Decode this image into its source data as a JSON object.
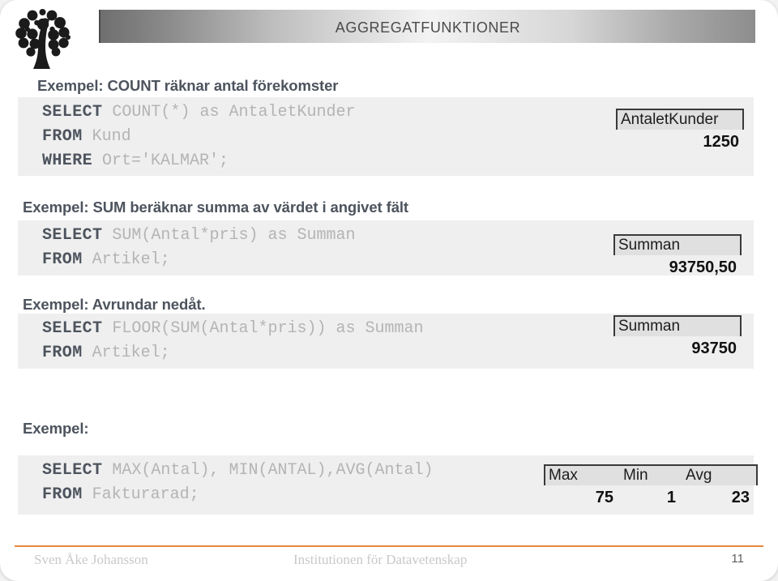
{
  "header": {
    "title": "Aggregatfunktioner",
    "logo_icon": "tree-logo-icon"
  },
  "sections": [
    {
      "heading": "Exempel:  COUNT räknar antal förekomster",
      "code_lines": [
        {
          "keyword": "SELECT",
          "rest": " COUNT(*) as AntaletKunder"
        },
        {
          "keyword": "FROM",
          "rest": " Kund"
        },
        {
          "keyword": "WHERE",
          "rest": " Ort='KALMAR';"
        }
      ],
      "result": {
        "columns": [
          "AntaletKunder"
        ],
        "values": [
          "1250"
        ]
      }
    },
    {
      "heading": "Exempel: SUM beräknar summa av värdet i angivet fält",
      "code_lines": [
        {
          "keyword": "SELECT",
          "rest": " SUM(Antal*pris) as Summan"
        },
        {
          "keyword": "FROM",
          "rest": " Artikel;"
        }
      ],
      "result": {
        "columns": [
          "Summan"
        ],
        "values": [
          "93750,50"
        ]
      }
    },
    {
      "heading": "Exempel: Avrundar nedåt.",
      "code_lines": [
        {
          "keyword": "SELECT",
          "rest": " FLOOR(SUM(Antal*pris)) as Summan"
        },
        {
          "keyword": "FROM",
          "rest": " Artikel;"
        }
      ],
      "result": {
        "columns": [
          "Summan"
        ],
        "values": [
          "93750"
        ]
      }
    },
    {
      "heading": "Exempel:",
      "code_lines": [
        {
          "keyword": "SELECT",
          "rest": " MAX(Antal), MIN(ANTAL),AVG(Antal)"
        },
        {
          "keyword": "FROM",
          "rest": " Fakturarad;"
        }
      ],
      "result": {
        "columns": [
          "Max",
          "Min",
          "Avg"
        ],
        "values": [
          "75",
          "1",
          "23"
        ]
      }
    }
  ],
  "footer": {
    "author": "Sven Åke Johansson",
    "department": "Institutionen för Datavetenskap",
    "page_number": "11",
    "rule_color": "#e8883a"
  }
}
